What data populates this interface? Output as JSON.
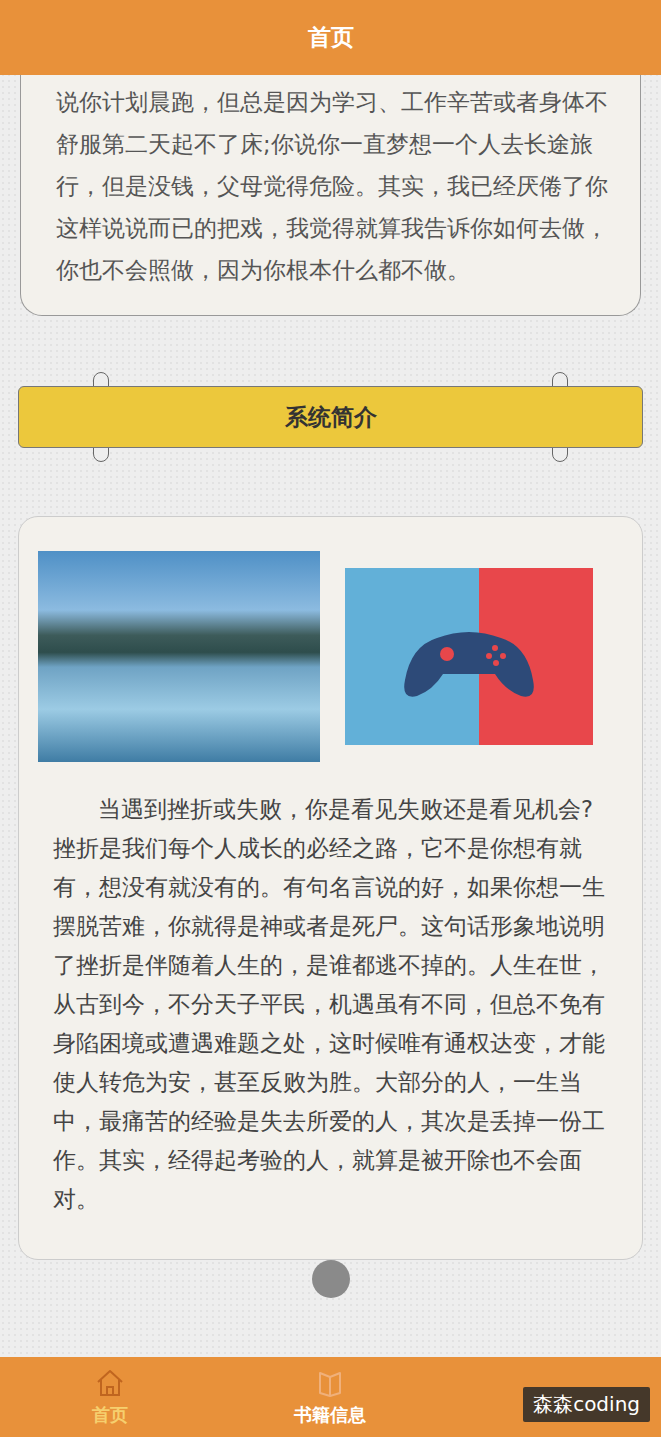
{
  "header": {
    "title": "首页"
  },
  "intro_card": {
    "text": "说你计划晨跑，但总是因为学习、工作辛苦或者身体不舒服第二天起不了床;你说你一直梦想一个人去长途旅行，但是没钱，父母觉得危险。其实，我已经厌倦了你这样说说而已的把戏，我觉得就算我告诉你如何去做，你也不会照做，因为你根本什么都不做。"
  },
  "section_banner": {
    "title": "系统简介"
  },
  "system_card": {
    "text": "当遇到挫折或失败，你是看见失败还是看见机会?挫折是我们每个人成长的必经之路，它不是你想有就有，想没有就没有的。有句名言说的好，如果你想一生摆脱苦难，你就得是神或者是死尸。这句话形象地说明了挫折是伴随着人生的，是谁都逃不掉的。人生在世，从古到今，不分天子平民，机遇虽有不同，但总不免有身陷困境或遭遇难题之处，这时候唯有通权达变，才能使人转危为安，甚至反败为胜。大部分的人，一生当中，最痛苦的经验是失去所爱的人，其次是丢掉一份工作。其实，经得起考验的人，就算是被开除也不会面对。"
  },
  "tabbar": {
    "items": [
      {
        "label": "首页",
        "selected": true
      },
      {
        "label": "书籍信息",
        "selected": false
      }
    ]
  },
  "watermark": {
    "text": "森森coding"
  }
}
